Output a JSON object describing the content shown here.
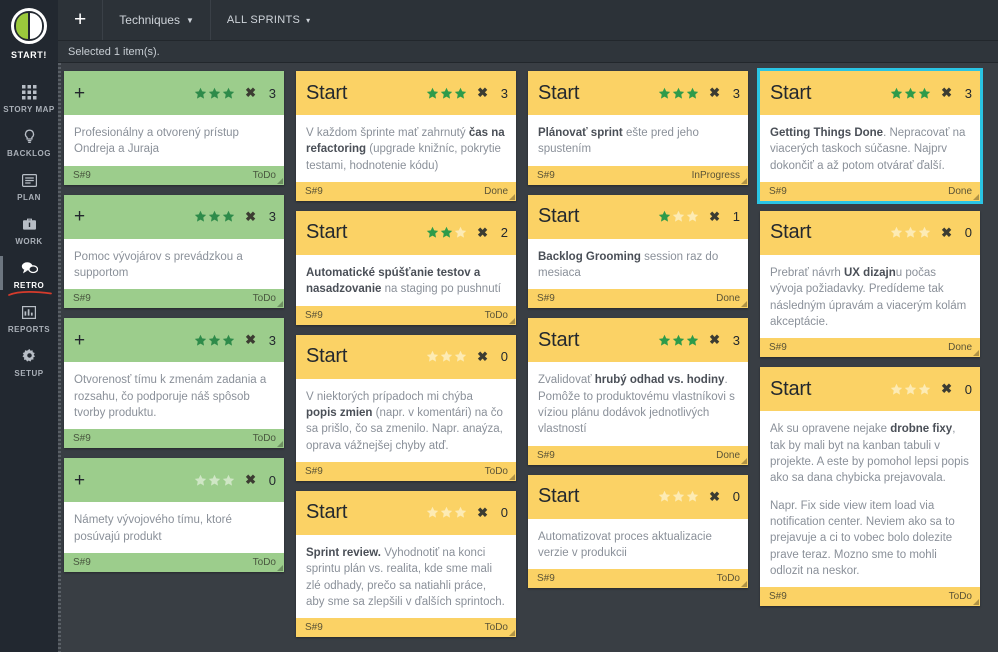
{
  "sidebar": {
    "logo": {
      "label": "START!",
      "icon": "logo-circle-icon"
    },
    "items": [
      {
        "label": "STORY MAP",
        "icon": "grid-icon",
        "active": false
      },
      {
        "label": "BACKLOG",
        "icon": "lightbulb-icon",
        "active": false
      },
      {
        "label": "PLAN",
        "icon": "list-icon",
        "active": false
      },
      {
        "label": "WORK",
        "icon": "briefcase-icon",
        "active": false
      },
      {
        "label": "RETRO",
        "icon": "chat-bubbles-icon",
        "active": true
      },
      {
        "label": "REPORTS",
        "icon": "bar-chart-icon",
        "active": false
      },
      {
        "label": "SETUP",
        "icon": "gear-icon",
        "active": false
      }
    ]
  },
  "topbar": {
    "add_label": "+",
    "techniques_label": "Techniques",
    "sprints_label": "ALL SPRINTS",
    "caret": "▼",
    "caret_small": "▾"
  },
  "selection_bar": {
    "text": "Selected 1 item(s)."
  },
  "colors": {
    "green_card": "#9ccd8c",
    "yellow_card": "#fbd265",
    "selected_border": "#2ac4e3",
    "star_on": "#2e9b4a",
    "star_off": "#fdebb4",
    "sidebar_bg": "#222830",
    "board_bg": "#393e44",
    "accent_green": "#9bc93c"
  },
  "board": {
    "columns": [
      {
        "name": "column-1",
        "cards": [
          {
            "head": "+",
            "head_type": "plus",
            "color": "green",
            "stars_on": 3,
            "stars_total": 3,
            "count": "3",
            "selected": false,
            "paragraphs": [
              [
                {
                  "t": "Profesionálny a otvorený prístup Ondreja a Juraja",
                  "b": false
                }
              ]
            ],
            "sprint": "S#9",
            "status": "ToDo"
          },
          {
            "head": "+",
            "head_type": "plus",
            "color": "green",
            "stars_on": 3,
            "stars_total": 3,
            "count": "3",
            "selected": false,
            "paragraphs": [
              [
                {
                  "t": "Pomoc vývojárov s prevádzkou a supportom",
                  "b": false
                }
              ]
            ],
            "sprint": "S#9",
            "status": "ToDo"
          },
          {
            "head": "+",
            "head_type": "plus",
            "color": "green",
            "stars_on": 3,
            "stars_total": 3,
            "count": "3",
            "selected": false,
            "paragraphs": [
              [
                {
                  "t": "Otvorenosť tímu k zmenám zadania a rozsahu, čo podporuje náš spôsob tvorby produktu.",
                  "b": false
                }
              ]
            ],
            "sprint": "S#9",
            "status": "ToDo"
          },
          {
            "head": "+",
            "head_type": "plus",
            "color": "green",
            "stars_on": 0,
            "stars_total": 3,
            "count": "0",
            "selected": false,
            "paragraphs": [
              [
                {
                  "t": "Námety vývojového tímu, ktoré posúvajú produkt",
                  "b": false
                }
              ]
            ],
            "sprint": "S#9",
            "status": "ToDo"
          }
        ]
      },
      {
        "name": "column-2",
        "cards": [
          {
            "head": "Start",
            "head_type": "title",
            "color": "yellow",
            "stars_on": 3,
            "stars_total": 3,
            "count": "3",
            "selected": false,
            "paragraphs": [
              [
                {
                  "t": "V každom šprinte mať zahrnutý ",
                  "b": false
                },
                {
                  "t": "čas na refactoring",
                  "b": true
                },
                {
                  "t": " (upgrade knižníc, pokrytie testami, hodnotenie kódu)",
                  "b": false
                }
              ]
            ],
            "sprint": "S#9",
            "status": "Done"
          },
          {
            "head": "Start",
            "head_type": "title",
            "color": "yellow",
            "stars_on": 2,
            "stars_total": 3,
            "count": "2",
            "selected": false,
            "paragraphs": [
              [
                {
                  "t": "Automatické spúšťanie testov a nasadzovanie",
                  "b": true
                },
                {
                  "t": " na staging po pushnutí",
                  "b": false
                }
              ]
            ],
            "sprint": "S#9",
            "status": "ToDo"
          },
          {
            "head": "Start",
            "head_type": "title",
            "color": "yellow",
            "stars_on": 0,
            "stars_total": 3,
            "count": "0",
            "selected": false,
            "paragraphs": [
              [
                {
                  "t": "V niektorých prípadoch mi chýba ",
                  "b": false
                },
                {
                  "t": "popis zmien",
                  "b": true
                },
                {
                  "t": " (napr. v komentári) na čo sa prišlo, čo sa zmenilo. Napr. anaýza, oprava vážnejšej chyby atď.",
                  "b": false
                }
              ]
            ],
            "sprint": "S#9",
            "status": "ToDo"
          },
          {
            "head": "Start",
            "head_type": "title",
            "color": "yellow",
            "stars_on": 0,
            "stars_total": 3,
            "count": "0",
            "selected": false,
            "paragraphs": [
              [
                {
                  "t": "Sprint review.",
                  "b": true
                },
                {
                  "t": " Vyhodnotiť na konci sprintu plán vs. realita, kde sme mali zlé odhady, prečo sa natiahli práce, aby sme sa zlepšili v ďalších sprintoch.",
                  "b": false
                }
              ]
            ],
            "sprint": "S#9",
            "status": "ToDo"
          }
        ]
      },
      {
        "name": "column-3",
        "cards": [
          {
            "head": "Start",
            "head_type": "title",
            "color": "yellow",
            "stars_on": 3,
            "stars_total": 3,
            "count": "3",
            "selected": false,
            "paragraphs": [
              [
                {
                  "t": "Plánovať sprint",
                  "b": true
                },
                {
                  "t": " ešte pred jeho spustením",
                  "b": false
                }
              ]
            ],
            "sprint": "S#9",
            "status": "InProgress"
          },
          {
            "head": "Start",
            "head_type": "title",
            "color": "yellow",
            "stars_on": 1,
            "stars_total": 3,
            "count": "1",
            "selected": false,
            "paragraphs": [
              [
                {
                  "t": "Backlog Grooming",
                  "b": true
                },
                {
                  "t": " session raz do mesiaca",
                  "b": false
                }
              ]
            ],
            "sprint": "S#9",
            "status": "Done"
          },
          {
            "head": "Start",
            "head_type": "title",
            "color": "yellow",
            "stars_on": 3,
            "stars_total": 3,
            "count": "3",
            "selected": false,
            "paragraphs": [
              [
                {
                  "t": "Zvalidovať ",
                  "b": false
                },
                {
                  "t": "hrubý odhad vs. hodiny",
                  "b": true
                },
                {
                  "t": ". Pomôže to produktovému vlastníkovi s víziou plánu dodávok jednotlivých vlastností",
                  "b": false
                }
              ]
            ],
            "sprint": "S#9",
            "status": "Done"
          },
          {
            "head": "Start",
            "head_type": "title",
            "color": "yellow",
            "stars_on": 0,
            "stars_total": 3,
            "count": "0",
            "selected": false,
            "paragraphs": [
              [
                {
                  "t": "Automatizovat proces aktualizacie verzie v produkcii",
                  "b": false
                }
              ]
            ],
            "sprint": "S#9",
            "status": "ToDo"
          }
        ]
      },
      {
        "name": "column-4",
        "cards": [
          {
            "head": "Start",
            "head_type": "title",
            "color": "yellow",
            "stars_on": 3,
            "stars_total": 3,
            "count": "3",
            "selected": true,
            "paragraphs": [
              [
                {
                  "t": "Getting Things Done",
                  "b": true
                },
                {
                  "t": ". Nepracovať na viacerých taskoch súčasne. Najprv dokončiť a až potom otvárať ďalší.",
                  "b": false
                }
              ]
            ],
            "sprint": "S#9",
            "status": "Done"
          },
          {
            "head": "Start",
            "head_type": "title",
            "color": "yellow",
            "stars_on": 0,
            "stars_total": 3,
            "count": "0",
            "selected": false,
            "paragraphs": [
              [
                {
                  "t": "Prebrať návrh ",
                  "b": false
                },
                {
                  "t": "UX dizajn",
                  "b": true
                },
                {
                  "t": "u počas vývoja požiadavky. Predídeme tak následným úpravám a viacerým kolám akceptácie.",
                  "b": false
                }
              ]
            ],
            "sprint": "S#9",
            "status": "Done"
          },
          {
            "head": "Start",
            "head_type": "title",
            "color": "yellow",
            "stars_on": 0,
            "stars_total": 3,
            "count": "0",
            "selected": false,
            "paragraphs": [
              [
                {
                  "t": "Ak su opravene nejake ",
                  "b": false
                },
                {
                  "t": "drobne fixy",
                  "b": true
                },
                {
                  "t": ", tak by mali byt na kanban tabuli v projekte. A este by pomohol lepsi popis ako sa dana chybicka prejavovala.",
                  "b": false
                }
              ],
              [
                {
                  "t": "Napr. Fix side view item load via notification center. Neviem ako sa to prejavuje a ci to vobec bolo dolezite prave teraz. Mozno sme to mohli odlozit na neskor.",
                  "b": false
                }
              ]
            ],
            "sprint": "S#9",
            "status": "ToDo"
          }
        ]
      }
    ]
  }
}
